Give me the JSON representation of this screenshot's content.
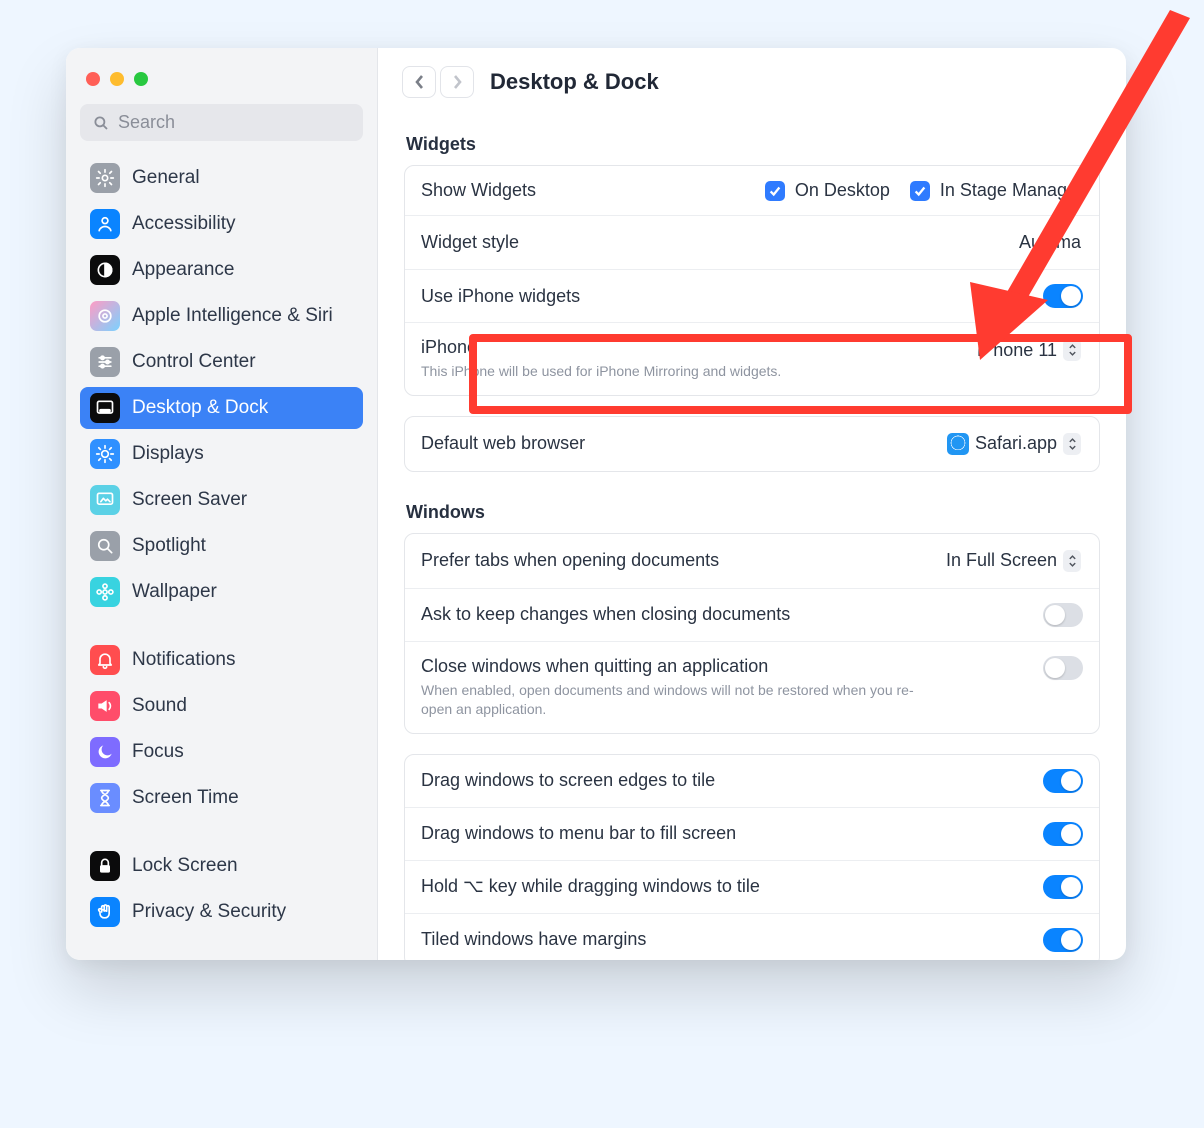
{
  "header": {
    "title": "Desktop & Dock"
  },
  "search": {
    "placeholder": "Search"
  },
  "sidebar": {
    "groups": [
      [
        {
          "label": "General",
          "icon": "gear",
          "bg": "#9aa0a9"
        },
        {
          "label": "Accessibility",
          "icon": "person",
          "bg": "#0a84ff"
        },
        {
          "label": "Appearance",
          "icon": "appearance",
          "bg": "#0b0b0c"
        },
        {
          "label": "Apple Intelligence & Siri",
          "icon": "ai",
          "bg": "linear-gradient(135deg,#ff9cc4,#7bd1ff)"
        },
        {
          "label": "Control Center",
          "icon": "sliders",
          "bg": "#9aa0a9"
        },
        {
          "label": "Desktop & Dock",
          "icon": "dock",
          "bg": "#0b0b0c",
          "selected": true
        },
        {
          "label": "Displays",
          "icon": "sun",
          "bg": "#2f90ff"
        },
        {
          "label": "Screen Saver",
          "icon": "screensaver",
          "bg": "#5bd1e6"
        },
        {
          "label": "Spotlight",
          "icon": "search",
          "bg": "#9aa0a9"
        },
        {
          "label": "Wallpaper",
          "icon": "flower",
          "bg": "#38d3e0"
        }
      ],
      [
        {
          "label": "Notifications",
          "icon": "bell",
          "bg": "#ff4d4f"
        },
        {
          "label": "Sound",
          "icon": "sound",
          "bg": "#ff4d6a"
        },
        {
          "label": "Focus",
          "icon": "moon",
          "bg": "#7e6cff"
        },
        {
          "label": "Screen Time",
          "icon": "hourglass",
          "bg": "#6a8dff"
        }
      ],
      [
        {
          "label": "Lock Screen",
          "icon": "lock",
          "bg": "#0b0b0c"
        },
        {
          "label": "Privacy & Security",
          "icon": "hand",
          "bg": "#0a84ff"
        }
      ]
    ]
  },
  "widgets": {
    "section": "Widgets",
    "show_label": "Show Widgets",
    "on_desktop": "On Desktop",
    "in_stage": "In Stage Manager",
    "style_label": "Widget style",
    "style_value": "Automa",
    "use_iphone": "Use iPhone widgets",
    "iphone_label": "iPhone",
    "iphone_value": "iPhone 11",
    "iphone_desc": "This iPhone will be used for iPhone Mirroring and widgets.",
    "browser_label": "Default web browser",
    "browser_value": "Safari.app"
  },
  "windows": {
    "section": "Windows",
    "tabs_label": "Prefer tabs when opening documents",
    "tabs_value": "In Full Screen",
    "ask_label": "Ask to keep changes when closing documents",
    "close_label": "Close windows when quitting an application",
    "close_desc": "When enabled, open documents and windows will not be restored when you re-open an application.",
    "drag_edges": "Drag windows to screen edges to tile",
    "drag_menu": "Drag windows to menu bar to fill screen",
    "hold_opt": "Hold ⌥ key while dragging windows to tile",
    "margins": "Tiled windows have margins"
  }
}
